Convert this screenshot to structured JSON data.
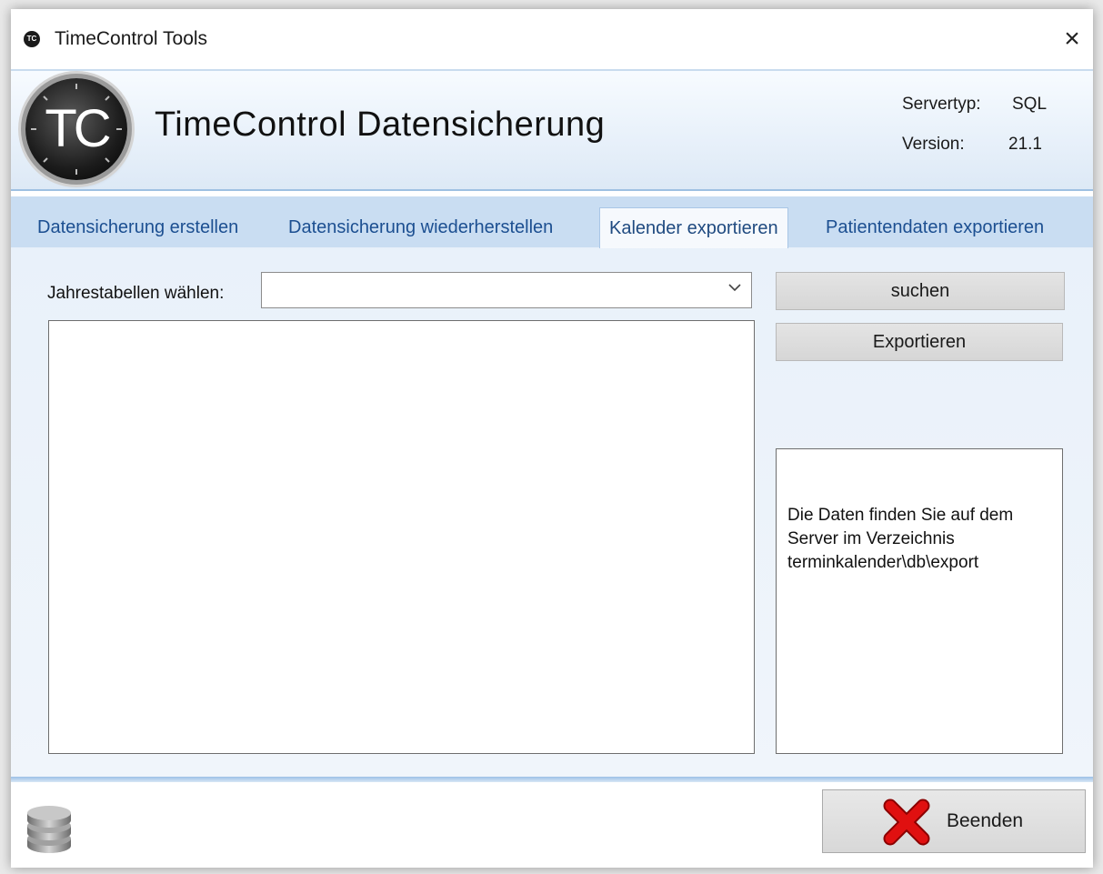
{
  "window": {
    "title": "TimeControl Tools",
    "app_icon_text": "TC",
    "close_symbol": "×"
  },
  "header": {
    "logo_text": "TC",
    "title": "TimeControl Datensicherung",
    "servertyp_label": "Servertyp:",
    "servertyp_value": "SQL",
    "version_label": "Version:",
    "version_value": "21.1"
  },
  "tabs": [
    {
      "label": "Datensicherung erstellen",
      "active": false
    },
    {
      "label": "Datensicherung wiederherstellen",
      "active": false
    },
    {
      "label": "Kalender exportieren",
      "active": true
    },
    {
      "label": "Patientendaten exportieren",
      "active": false
    }
  ],
  "export_panel": {
    "year_tables_label": "Jahrestabellen wählen:",
    "year_tables_value": "",
    "search_button": "suchen",
    "export_button": "Exportieren",
    "info_lines": [
      "Die Daten finden Sie auf dem",
      "Server im Verzeichnis",
      "terminkalender\\db\\export"
    ]
  },
  "footer": {
    "exit_button": "Beenden"
  },
  "icons": {
    "app": "timecontrol-logo-icon",
    "close": "close-icon",
    "dropdown": "chevron-down-icon",
    "database": "database-icon",
    "exit": "red-x-icon"
  },
  "colors": {
    "tab_text": "#1c4f91",
    "header_gradient_bottom": "#dde9f6",
    "tab_strip": "#c9ddf2",
    "exit_icon": "#e01010"
  }
}
